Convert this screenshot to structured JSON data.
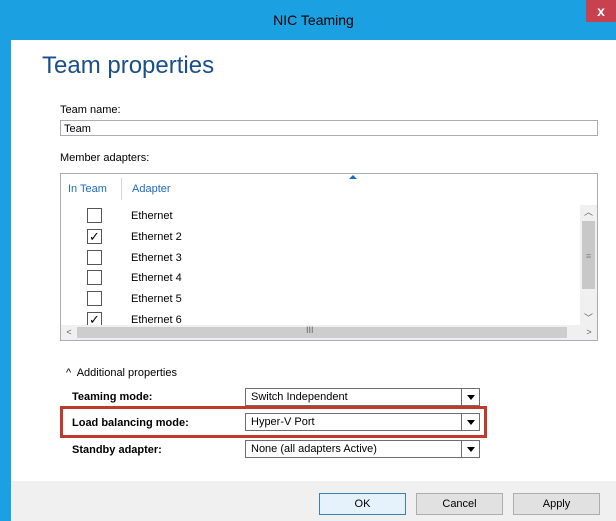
{
  "window": {
    "title": "NIC Teaming",
    "close_glyph": "x"
  },
  "heading": "Team properties",
  "team_name": {
    "label": "Team name:",
    "value": "Team"
  },
  "members": {
    "label": "Member adapters:",
    "col_in_team": "In Team",
    "col_adapter": "Adapter",
    "adapters": [
      {
        "name": "Ethernet",
        "checked": false
      },
      {
        "name": "Ethernet 2",
        "checked": true
      },
      {
        "name": "Ethernet 3",
        "checked": false
      },
      {
        "name": "Ethernet 4",
        "checked": false
      },
      {
        "name": "Ethernet 5",
        "checked": false
      },
      {
        "name": "Ethernet 6",
        "checked": true
      }
    ]
  },
  "additional": {
    "toggle_label": "Additional properties",
    "teaming_mode": {
      "label": "Teaming mode:",
      "value": "Switch Independent"
    },
    "load_balancing": {
      "label": "Load balancing mode:",
      "value": "Hyper-V Port"
    },
    "standby": {
      "label": "Standby adapter:",
      "value": "None (all adapters Active)"
    }
  },
  "buttons": {
    "ok": "OK",
    "cancel": "Cancel",
    "apply": "Apply"
  },
  "colors": {
    "titlebar": "#1ba1e2",
    "heading": "#1a4f8f",
    "highlight": "#c0392b"
  }
}
